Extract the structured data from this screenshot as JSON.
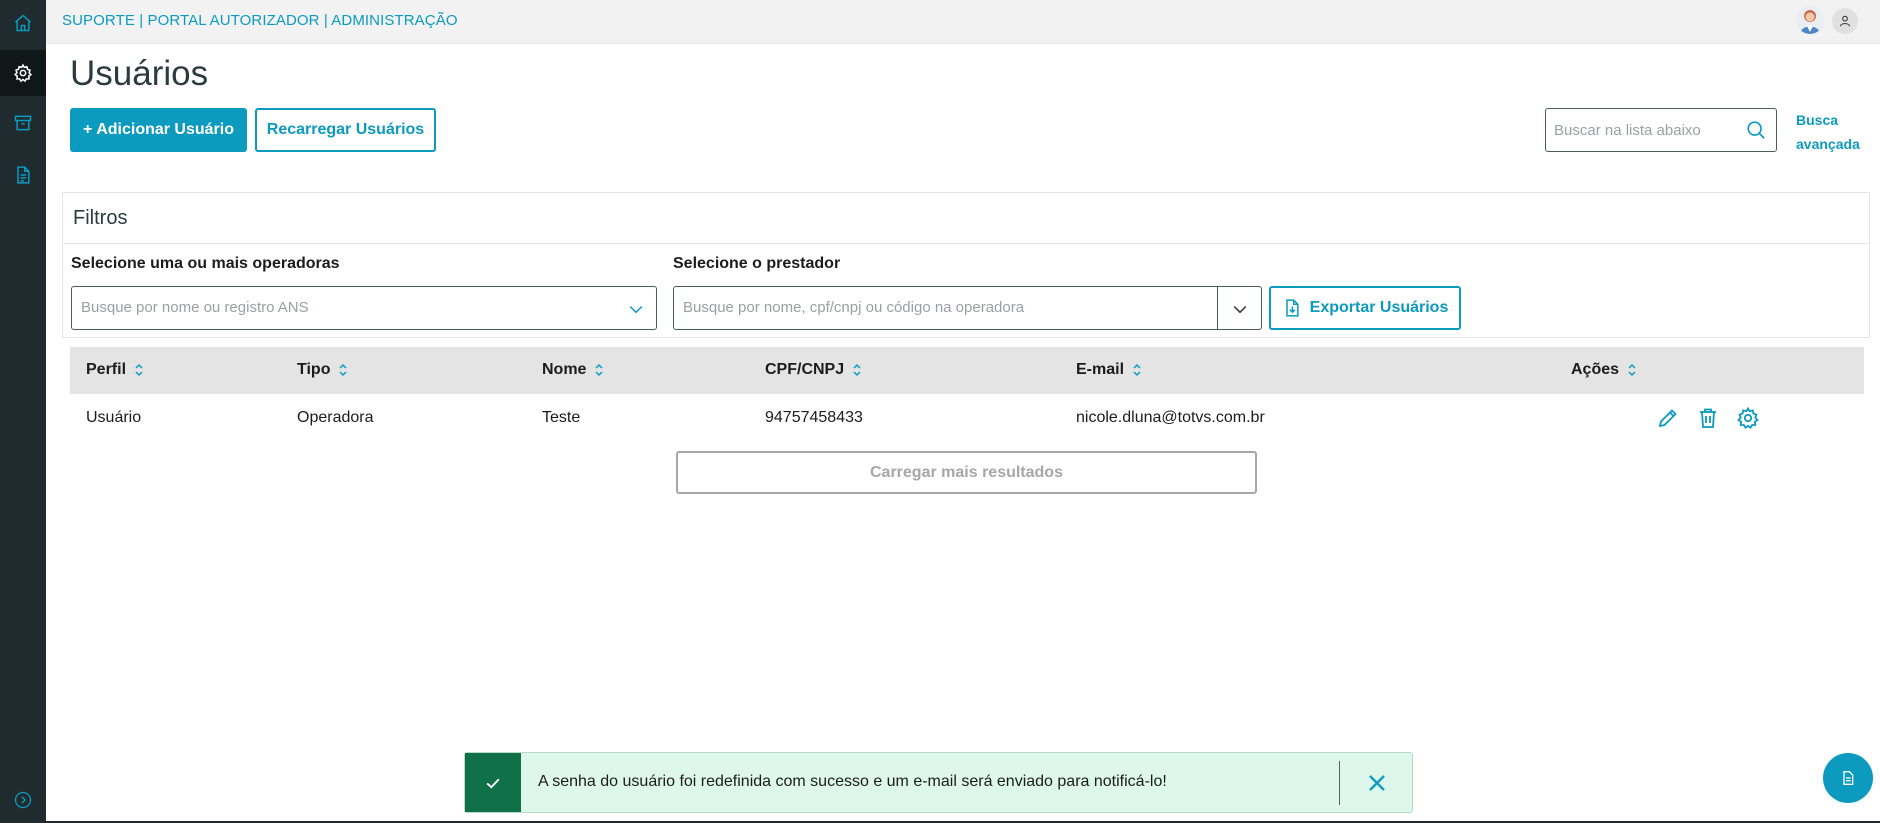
{
  "header": {
    "breadcrumb": "SUPORTE | PORTAL AUTORIZADOR | ADMINISTRAÇÃO"
  },
  "page": {
    "title": "Usuários"
  },
  "toolbar": {
    "add_label": "+ Adicionar Usuário",
    "reload_label": "Recarregar Usuários"
  },
  "search": {
    "placeholder": "Buscar na lista abaixo",
    "advanced_line1": "Busca",
    "advanced_line2": "avançada"
  },
  "filters": {
    "title": "Filtros",
    "operadoras_label": "Selecione uma ou mais operadoras",
    "operadoras_placeholder": "Busque por nome ou registro ANS",
    "prestador_label": "Selecione o prestador",
    "prestador_placeholder": "Busque por nome, cpf/cnpj ou código na operadora",
    "export_label": "Exportar Usuários"
  },
  "table": {
    "columns": [
      "Perfil",
      "Tipo",
      "Nome",
      "CPF/CNPJ",
      "E-mail",
      "Ações"
    ],
    "rows": [
      {
        "perfil": "Usuário",
        "tipo": "Operadora",
        "nome": "Teste",
        "cpf": "94757458433",
        "email": "nicole.dluna@totvs.com.br",
        "actions": [
          "edit-icon",
          "trash-icon",
          "gear-icon"
        ]
      }
    ],
    "load_more": "Carregar mais resultados"
  },
  "toast": {
    "message": "A senha do usuário foi redefinida com sucesso e um e-mail será enviado para notificá-lo!"
  },
  "colors": {
    "primary": "#0c9abe",
    "sidebar": "#1f2b2e",
    "success": "#107048",
    "success_bg": "#def7ed"
  },
  "icons": {
    "sidebar": [
      "home-icon",
      "gear-icon",
      "archive-icon",
      "document-icon",
      "expand-icon"
    ],
    "fab": "document-icon"
  }
}
